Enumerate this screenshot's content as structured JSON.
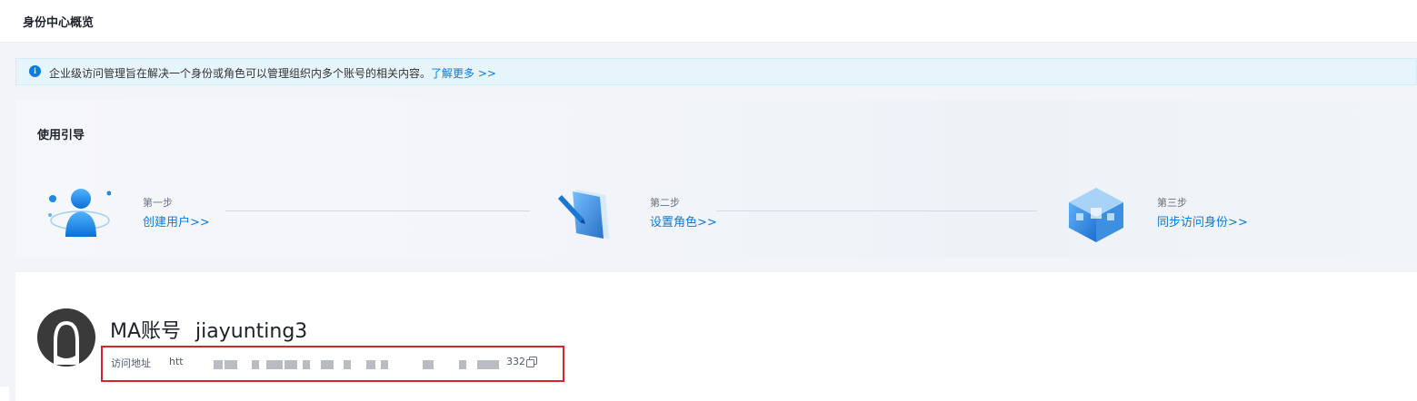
{
  "header": {
    "title": "身份中心概览"
  },
  "notice": {
    "text": "企业级访问管理旨在解决一个身份或角色可以管理组织内多个账号的相关内容。",
    "link": "了解更多 >>"
  },
  "guide": {
    "title": "使用引导",
    "steps": [
      {
        "label": "第一步",
        "action": "创建用户>>",
        "icon": "user-icon"
      },
      {
        "label": "第二步",
        "action": "设置角色>>",
        "icon": "role-edit-icon"
      },
      {
        "label": "第三步",
        "action": "同步访问身份>>",
        "icon": "sync-cube-icon"
      }
    ]
  },
  "account": {
    "type": "MA账号",
    "name": "jiayunting3",
    "access_label": "访问地址",
    "access_prefix": "htt",
    "access_suffix": "332"
  }
}
